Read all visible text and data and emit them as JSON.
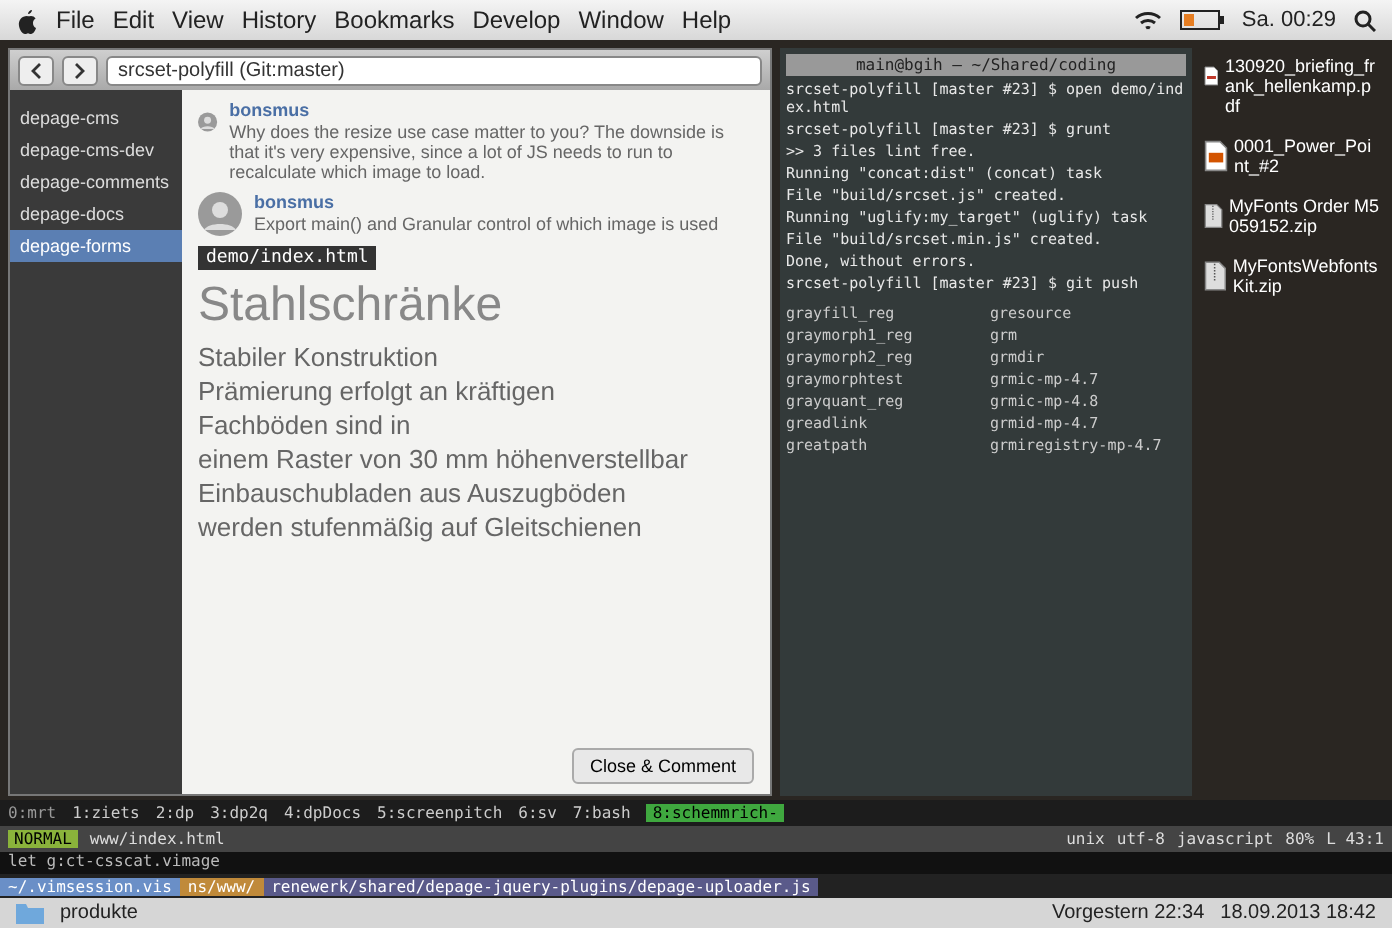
{
  "menu_bar": {
    "items": [
      "File",
      "Edit",
      "View",
      "History",
      "Bookmarks",
      "Develop",
      "Window",
      "Help"
    ],
    "clock": "Sa. 00:29"
  },
  "browser": {
    "url": "srcset-polyfill (Git:master)",
    "sidebar": {
      "items": [
        {
          "label": "depage-cms",
          "selected": false
        },
        {
          "label": "depage-cms-dev",
          "selected": false
        },
        {
          "label": "depage-comments",
          "selected": false
        },
        {
          "label": "depage-docs",
          "selected": false
        },
        {
          "label": "depage-forms",
          "selected": true
        }
      ]
    },
    "comments": [
      {
        "author": "bonsmus",
        "text": "Why does the resize use case matter to you? The downside is that it's very expensive, since a lot of JS needs to run to recalculate which image to load."
      },
      {
        "author": "bonsmus",
        "text": "Export main() and Granular control of which image is used"
      }
    ],
    "editor_file": "demo/index.html",
    "heading": "Stahlschränke",
    "lines": [
      "Stabiler Konstruktion",
      "Prämierung erfolgt an kräftigen",
      "Fachböden sind in",
      "einem Raster von 30 mm höhenverstellbar",
      "Einbauschubladen aus Auszugböden",
      "werden stufenmäßig auf Gleitschienen"
    ],
    "button": "Close & Comment"
  },
  "terminal": {
    "title": "main@bgih — ~/Shared/coding",
    "lines": [
      "srcset-polyfill [master #23] $ open demo/index.html",
      "srcset-polyfill [master #23] $ grunt",
      ">> 3 files lint free.",
      "Running \"concat:dist\" (concat) task",
      "File \"build/srcset.js\" created.",
      "Running \"uglify:my_target\" (uglify) task",
      "File \"build/srcset.min.js\" created.",
      "Done, without errors.",
      "srcset-polyfill [master #23] $ git push"
    ],
    "listing": [
      "grayfill_reg",
      "gresource",
      "graymorph1_reg",
      "grm",
      "graymorph2_reg",
      "grmdir",
      "graymorphtest",
      "grmic-mp-4.7",
      "grayquant_reg",
      "grmic-mp-4.8",
      "greadlink",
      "grmid-mp-4.7",
      "greatpath",
      "grmiregistry-mp-4.7"
    ]
  },
  "desktop_files": [
    {
      "name": "130920_briefing_frank_hellenkamp.pdf",
      "kind": "pdf"
    },
    {
      "name": "0001_Power_Point_#2",
      "kind": "doc"
    },
    {
      "name": "MyFonts Order M5059152.zip",
      "kind": "zip"
    },
    {
      "name": "MyFontsWebfontsKit.zip",
      "kind": "zip"
    }
  ],
  "tmux": {
    "session": "0:mrt",
    "windows": [
      {
        "label": "1:ziets",
        "selected": false
      },
      {
        "label": "2:dp",
        "selected": false
      },
      {
        "label": "3:dp2q",
        "selected": false
      },
      {
        "label": "4:dpDocs",
        "selected": false
      },
      {
        "label": "5:screenpitch",
        "selected": false
      },
      {
        "label": "6:sv",
        "selected": false
      },
      {
        "label": "7:bash",
        "selected": false
      },
      {
        "label": "8:schemmrich-",
        "selected": true
      }
    ]
  },
  "vim_status": {
    "mode": "NORMAL",
    "file": "www/index.html",
    "segments": [
      "unix",
      "utf-8",
      "javascript",
      "80%",
      "L 43:1"
    ]
  },
  "vim_command": "let g:ct-csscat.vimage",
  "path_bar": {
    "session": "~/.vimsession.vis",
    "segments": [
      "ns/www/",
      "renewerk/shared/depage-jquery-plugins/depage-uploader.js"
    ]
  },
  "finder_bar": {
    "folder": "produkte",
    "modified": "Vorgestern 22:34",
    "date": "18.09.2013 18:42"
  }
}
